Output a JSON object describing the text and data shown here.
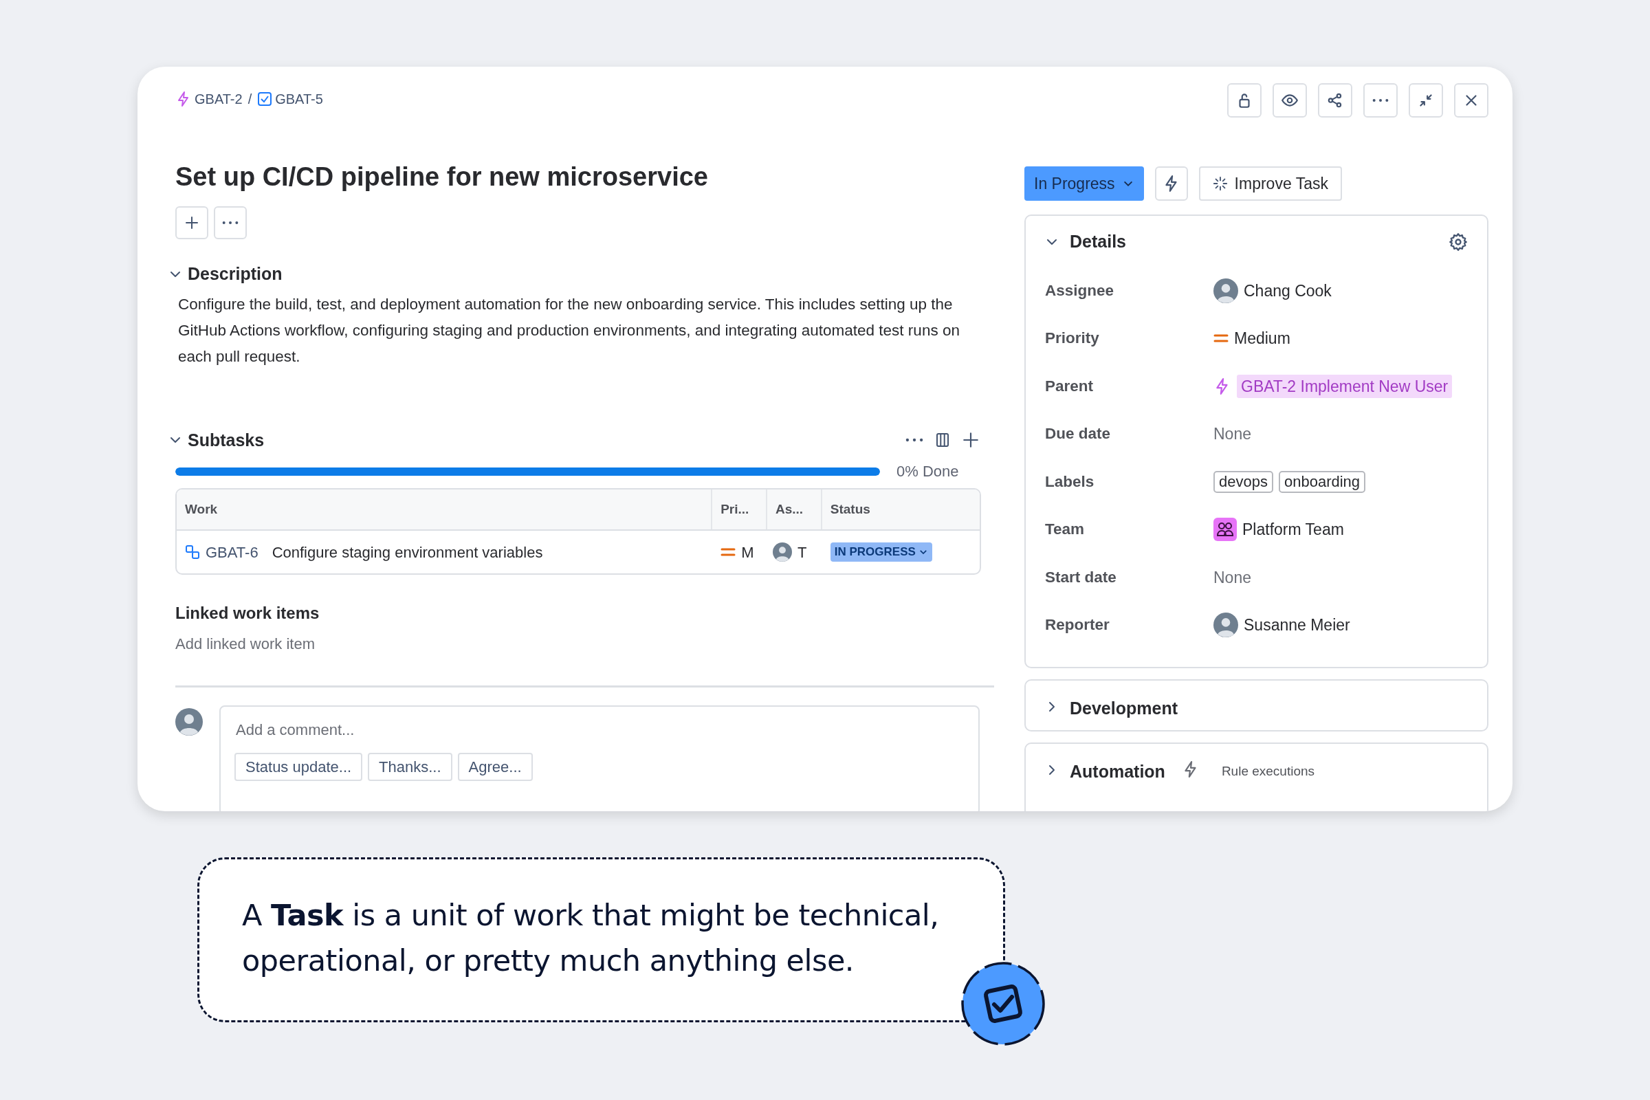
{
  "breadcrumb": {
    "items": [
      {
        "kind": "epic",
        "label": "GBAT-2"
      },
      {
        "kind": "task",
        "label": "GBAT-5"
      }
    ],
    "separator": "/"
  },
  "title": "Set up CI/CD pipeline for new microservice",
  "description": {
    "heading": "Description",
    "expanded": true,
    "text": "Configure the build, test, and deployment automation for the new onboarding service. This includes setting up the GitHub Actions workflow, configuring staging and production environments, and integrating automated test runs on each pull request."
  },
  "subtasks": {
    "heading": "Subtasks",
    "expanded": true,
    "progress": {
      "level": 1
    },
    "done_text": "0% Done",
    "columns": [
      "Work",
      "Pri...",
      "As...",
      "Status"
    ],
    "rows": [
      {
        "key": "GBAT-6",
        "summary": "Configure staging environment variables",
        "priority": "M",
        "assignee": "T",
        "status": "IN PROGRESS"
      }
    ]
  },
  "linked": {
    "heading": "Linked work items",
    "action": "Add linked work item"
  },
  "comment": {
    "placeholder": "Add a comment...",
    "suggestions": [
      "Status update...",
      "Thanks...",
      "Agree..."
    ]
  },
  "status_button": "In Progress",
  "improve_button": "Improve Task",
  "details": {
    "heading": "Details",
    "expanded": true,
    "fields": [
      {
        "label": "Assignee",
        "kind": "user",
        "value": "Chang Cook"
      },
      {
        "label": "Priority",
        "kind": "priority",
        "value": "Medium"
      },
      {
        "label": "Parent",
        "kind": "parent",
        "value": "GBAT-2 Implement New User"
      },
      {
        "label": "Due date",
        "kind": "empty",
        "value": "None"
      },
      {
        "label": "Labels",
        "kind": "labels",
        "labels": [
          "devops",
          "onboarding"
        ]
      },
      {
        "label": "Team",
        "kind": "team",
        "value": "Platform Team"
      },
      {
        "label": "Start date",
        "kind": "empty",
        "value": "None"
      },
      {
        "label": "Reporter",
        "kind": "user",
        "value": "Susanne Meier"
      }
    ]
  },
  "panels": [
    {
      "heading": "Development",
      "expanded": false
    },
    {
      "heading": "Automation",
      "expanded": false,
      "note": "Rule executions"
    }
  ],
  "callout": {
    "text": "A **Task** is a unit of work that might be technical, operational, or pretty much anything else."
  }
}
